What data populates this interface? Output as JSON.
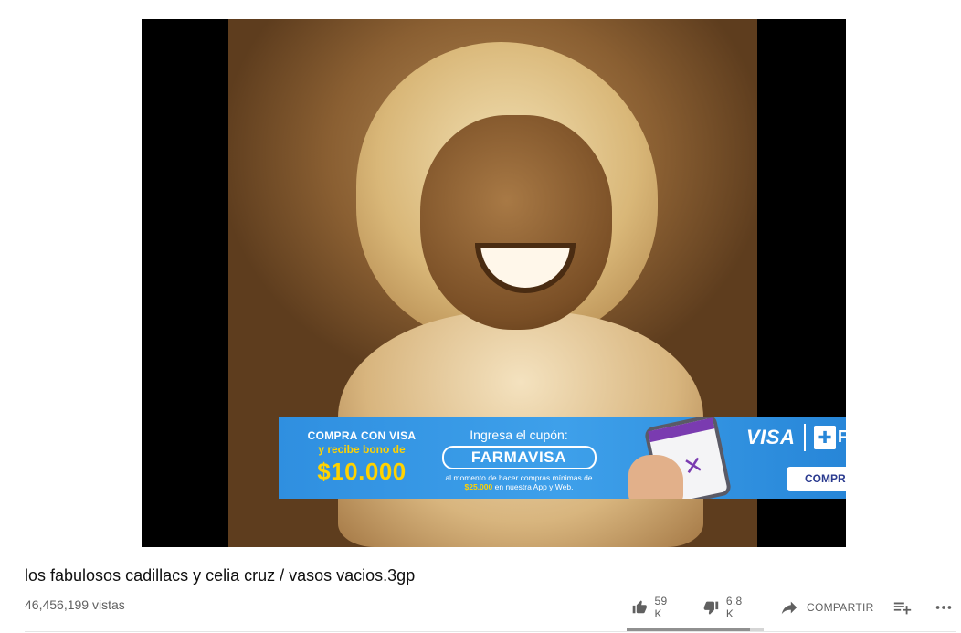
{
  "ad": {
    "line1": "COMPRA CON VISA",
    "line2": "y recibe bono de",
    "amount": "$10.000",
    "coupon_label": "Ingresa el cupón:",
    "coupon_code": "FARMAVISA",
    "fine_print_1": "al momento de hacer compras mínimas de",
    "fine_print_amount": "$25.000",
    "fine_print_2": "en nuestra App y Web.",
    "brand": "VISA",
    "brand2": "F",
    "cta": "COMPR"
  },
  "video": {
    "title": "los fabulosos cadillacs y celia cruz / vasos vacios.3gp",
    "views": "46,456,199 vistas",
    "likes": "59 K",
    "dislikes": "6.8 K",
    "share_label": "COMPARTIR",
    "like_ratio": 0.9
  },
  "icons": {
    "like": "thumb-up-icon",
    "dislike": "thumb-down-icon",
    "share": "share-arrow-icon",
    "save": "playlist-add-icon",
    "more": "more-horizontal-icon"
  }
}
